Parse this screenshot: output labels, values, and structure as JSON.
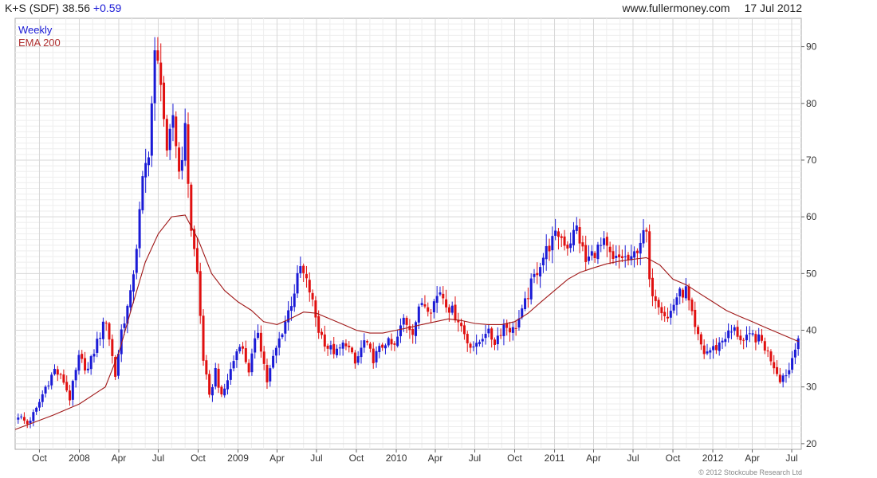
{
  "header": {
    "symbol": "K+S (SDF)",
    "price": "38.56",
    "change": "+0.59",
    "site": "www.fullermoney.com",
    "date": "17 Jul 2012"
  },
  "legend": {
    "frequency": "Weekly",
    "indicator": "EMA 200"
  },
  "copyright": "© 2012 Stockcube Research Ltd",
  "colors": {
    "up": "#1a1ad6",
    "down": "#e01010",
    "ema": "#a01818",
    "grid": "#d7d7d7",
    "frame": "#aaaaaa"
  },
  "chart_data": {
    "type": "candlestick",
    "frequency": "weekly",
    "ylim": [
      19,
      95
    ],
    "yticks": [
      20,
      30,
      40,
      50,
      60,
      70,
      80,
      90
    ],
    "y_axis_side": "right",
    "grid": true,
    "xlim": [
      "2007-08-06",
      "2012-07-23"
    ],
    "xticks": [
      {
        "label": "Oct",
        "date": "2007-10-01"
      },
      {
        "label": "2008",
        "date": "2008-01-01"
      },
      {
        "label": "Apr",
        "date": "2008-04-01"
      },
      {
        "label": "Jul",
        "date": "2008-07-01"
      },
      {
        "label": "Oct",
        "date": "2008-10-01"
      },
      {
        "label": "2009",
        "date": "2009-01-01"
      },
      {
        "label": "Apr",
        "date": "2009-04-01"
      },
      {
        "label": "Jul",
        "date": "2009-07-01"
      },
      {
        "label": "Oct",
        "date": "2009-10-01"
      },
      {
        "label": "2010",
        "date": "2010-01-01"
      },
      {
        "label": "Apr",
        "date": "2010-04-01"
      },
      {
        "label": "Jul",
        "date": "2010-07-01"
      },
      {
        "label": "Oct",
        "date": "2010-10-01"
      },
      {
        "label": "2011",
        "date": "2011-01-01"
      },
      {
        "label": "Apr",
        "date": "2011-04-01"
      },
      {
        "label": "Jul",
        "date": "2011-07-01"
      },
      {
        "label": "Oct",
        "date": "2011-10-01"
      },
      {
        "label": "2012",
        "date": "2012-01-01"
      },
      {
        "label": "Apr",
        "date": "2012-04-01"
      },
      {
        "label": "Jul",
        "date": "2012-07-01"
      }
    ],
    "close_path": [
      [
        "2007-08-13",
        25
      ],
      [
        "2007-09-03",
        23.5
      ],
      [
        "2007-09-24",
        26
      ],
      [
        "2007-10-15",
        30
      ],
      [
        "2007-11-05",
        33
      ],
      [
        "2007-11-26",
        31
      ],
      [
        "2007-12-10",
        28
      ],
      [
        "2007-12-31",
        35
      ],
      [
        "2008-01-21",
        33
      ],
      [
        "2008-02-11",
        38
      ],
      [
        "2008-03-03",
        42
      ],
      [
        "2008-03-24",
        32
      ],
      [
        "2008-04-07",
        40
      ],
      [
        "2008-04-28",
        46
      ],
      [
        "2008-05-12",
        55
      ],
      [
        "2008-05-26",
        66
      ],
      [
        "2008-06-09",
        72
      ],
      [
        "2008-06-23",
        88
      ],
      [
        "2008-07-07",
        85
      ],
      [
        "2008-07-21",
        70
      ],
      [
        "2008-08-04",
        78
      ],
      [
        "2008-08-18",
        68
      ],
      [
        "2008-09-01",
        75
      ],
      [
        "2008-09-15",
        58
      ],
      [
        "2008-09-29",
        50
      ],
      [
        "2008-10-13",
        35
      ],
      [
        "2008-10-27",
        28
      ],
      [
        "2008-11-10",
        33
      ],
      [
        "2008-11-24",
        28
      ],
      [
        "2008-12-15",
        33
      ],
      [
        "2009-01-05",
        38
      ],
      [
        "2009-01-26",
        33
      ],
      [
        "2009-02-16",
        40
      ],
      [
        "2009-03-09",
        31
      ],
      [
        "2009-03-23",
        35
      ],
      [
        "2009-04-13",
        40
      ],
      [
        "2009-05-04",
        45
      ],
      [
        "2009-05-25",
        51
      ],
      [
        "2009-06-15",
        47
      ],
      [
        "2009-07-06",
        40
      ],
      [
        "2009-07-27",
        37
      ],
      [
        "2009-08-17",
        36
      ],
      [
        "2009-09-07",
        38
      ],
      [
        "2009-09-28",
        34
      ],
      [
        "2009-10-19",
        38
      ],
      [
        "2009-11-09",
        35
      ],
      [
        "2009-12-07",
        38
      ],
      [
        "2009-12-28",
        37
      ],
      [
        "2010-01-18",
        42
      ],
      [
        "2010-02-08",
        40
      ],
      [
        "2010-03-01",
        45
      ],
      [
        "2010-03-22",
        44
      ],
      [
        "2010-04-12",
        47
      ],
      [
        "2010-05-03",
        44
      ],
      [
        "2010-05-24",
        42
      ],
      [
        "2010-06-14",
        38
      ],
      [
        "2010-07-05",
        37
      ],
      [
        "2010-07-26",
        40
      ],
      [
        "2010-08-16",
        38
      ],
      [
        "2010-09-06",
        41
      ],
      [
        "2010-09-27",
        40
      ],
      [
        "2010-10-18",
        43
      ],
      [
        "2010-11-08",
        48
      ],
      [
        "2010-11-29",
        52
      ],
      [
        "2010-12-20",
        55
      ],
      [
        "2011-01-10",
        57
      ],
      [
        "2011-01-31",
        55
      ],
      [
        "2011-02-21",
        58
      ],
      [
        "2011-03-14",
        52
      ],
      [
        "2011-04-04",
        54
      ],
      [
        "2011-04-25",
        55
      ],
      [
        "2011-05-16",
        52
      ],
      [
        "2011-06-06",
        53
      ],
      [
        "2011-06-27",
        52
      ],
      [
        "2011-07-18",
        56
      ],
      [
        "2011-08-01",
        57
      ],
      [
        "2011-08-08",
        48
      ],
      [
        "2011-08-29",
        45
      ],
      [
        "2011-09-19",
        42
      ],
      [
        "2011-10-10",
        46
      ],
      [
        "2011-10-31",
        47
      ],
      [
        "2011-11-21",
        40
      ],
      [
        "2011-12-12",
        36
      ],
      [
        "2012-01-09",
        37
      ],
      [
        "2012-01-30",
        39
      ],
      [
        "2012-02-20",
        40
      ],
      [
        "2012-03-12",
        38
      ],
      [
        "2012-04-02",
        39
      ],
      [
        "2012-04-23",
        38
      ],
      [
        "2012-05-14",
        35
      ],
      [
        "2012-06-04",
        31.5
      ],
      [
        "2012-06-25",
        33
      ],
      [
        "2012-07-09",
        37.5
      ],
      [
        "2012-07-16",
        38.56
      ]
    ],
    "ema_200": [
      [
        "2007-08-06",
        22.5
      ],
      [
        "2007-11-01",
        25
      ],
      [
        "2008-01-01",
        27
      ],
      [
        "2008-03-01",
        30
      ],
      [
        "2008-04-01",
        36
      ],
      [
        "2008-05-01",
        44
      ],
      [
        "2008-06-01",
        52
      ],
      [
        "2008-07-01",
        57
      ],
      [
        "2008-08-01",
        60
      ],
      [
        "2008-09-01",
        60.3
      ],
      [
        "2008-10-01",
        56
      ],
      [
        "2008-11-01",
        50
      ],
      [
        "2008-12-01",
        47
      ],
      [
        "2009-01-01",
        45
      ],
      [
        "2009-02-01",
        43.5
      ],
      [
        "2009-03-01",
        41.5
      ],
      [
        "2009-04-01",
        41
      ],
      [
        "2009-05-01",
        42
      ],
      [
        "2009-06-01",
        43.2
      ],
      [
        "2009-07-01",
        43
      ],
      [
        "2009-08-01",
        42
      ],
      [
        "2009-09-01",
        41
      ],
      [
        "2009-10-01",
        40
      ],
      [
        "2009-11-01",
        39.5
      ],
      [
        "2009-12-01",
        39.5
      ],
      [
        "2010-01-01",
        40
      ],
      [
        "2010-02-01",
        40.5
      ],
      [
        "2010-03-01",
        41
      ],
      [
        "2010-04-01",
        41.5
      ],
      [
        "2010-05-01",
        42
      ],
      [
        "2010-06-01",
        41.7
      ],
      [
        "2010-07-01",
        41.2
      ],
      [
        "2010-08-01",
        41
      ],
      [
        "2010-09-01",
        41
      ],
      [
        "2010-10-01",
        41.5
      ],
      [
        "2010-11-01",
        43
      ],
      [
        "2010-12-01",
        45
      ],
      [
        "2011-01-01",
        47
      ],
      [
        "2011-02-01",
        49
      ],
      [
        "2011-03-01",
        50.2
      ],
      [
        "2011-04-01",
        51
      ],
      [
        "2011-05-01",
        51.7
      ],
      [
        "2011-06-01",
        52.2
      ],
      [
        "2011-07-01",
        52.5
      ],
      [
        "2011-08-01",
        52.8
      ],
      [
        "2011-09-01",
        51.5
      ],
      [
        "2011-10-01",
        49
      ],
      [
        "2011-11-01",
        48
      ],
      [
        "2011-12-01",
        46.5
      ],
      [
        "2012-01-01",
        45
      ],
      [
        "2012-02-01",
        43.5
      ],
      [
        "2012-03-01",
        42.5
      ],
      [
        "2012-04-01",
        41.5
      ],
      [
        "2012-05-01",
        40.5
      ],
      [
        "2012-06-01",
        39.5
      ],
      [
        "2012-07-17",
        38
      ]
    ]
  }
}
